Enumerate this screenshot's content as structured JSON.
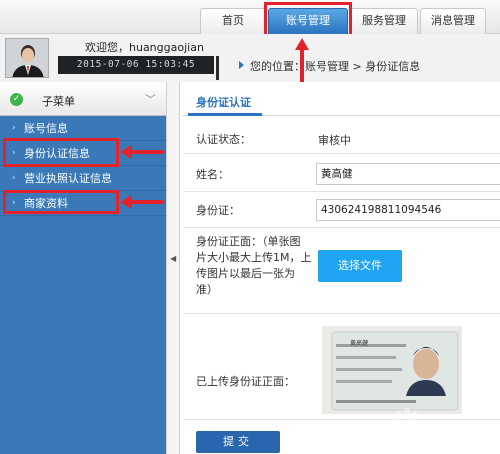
{
  "top_nav": {
    "tabs": [
      {
        "label": "首页"
      },
      {
        "label": "账号管理"
      },
      {
        "label": "服务管理"
      },
      {
        "label": "消息管理"
      }
    ]
  },
  "user": {
    "welcome": "欢迎您，huanggaojian",
    "datetime": "2015-07-06 15:03:45"
  },
  "breadcrumb": {
    "text": "您的位置：账号管理 > 身份证信息"
  },
  "sidebar": {
    "title": "子菜单",
    "items": [
      {
        "label": "账号信息"
      },
      {
        "label": "身份认证信息"
      },
      {
        "label": "营业执照认证信息"
      },
      {
        "label": "商家资料"
      }
    ]
  },
  "main": {
    "section_title": "身份证认证",
    "status_label": "认证状态：",
    "status_value": "审核中",
    "name_label": "姓名：",
    "name_value": "黄高健",
    "id_label": "身份证：",
    "id_value": "430624198811094546",
    "upload_label_lines": [
      "身份证正面：（单张图",
      "片大小最大上传1M，上",
      "传图片以最后一张为",
      "准）"
    ],
    "choose_file_label": "选择文件",
    "uploaded_label": "已上传身份证正面：",
    "photo_name": "黄高健",
    "submit_label": "提交"
  },
  "colors": {
    "accent_blue": "#2a74bf",
    "sidebar_blue": "#3a78b8",
    "file_button": "#1ea4f0",
    "highlight_red": "#e3222c"
  }
}
